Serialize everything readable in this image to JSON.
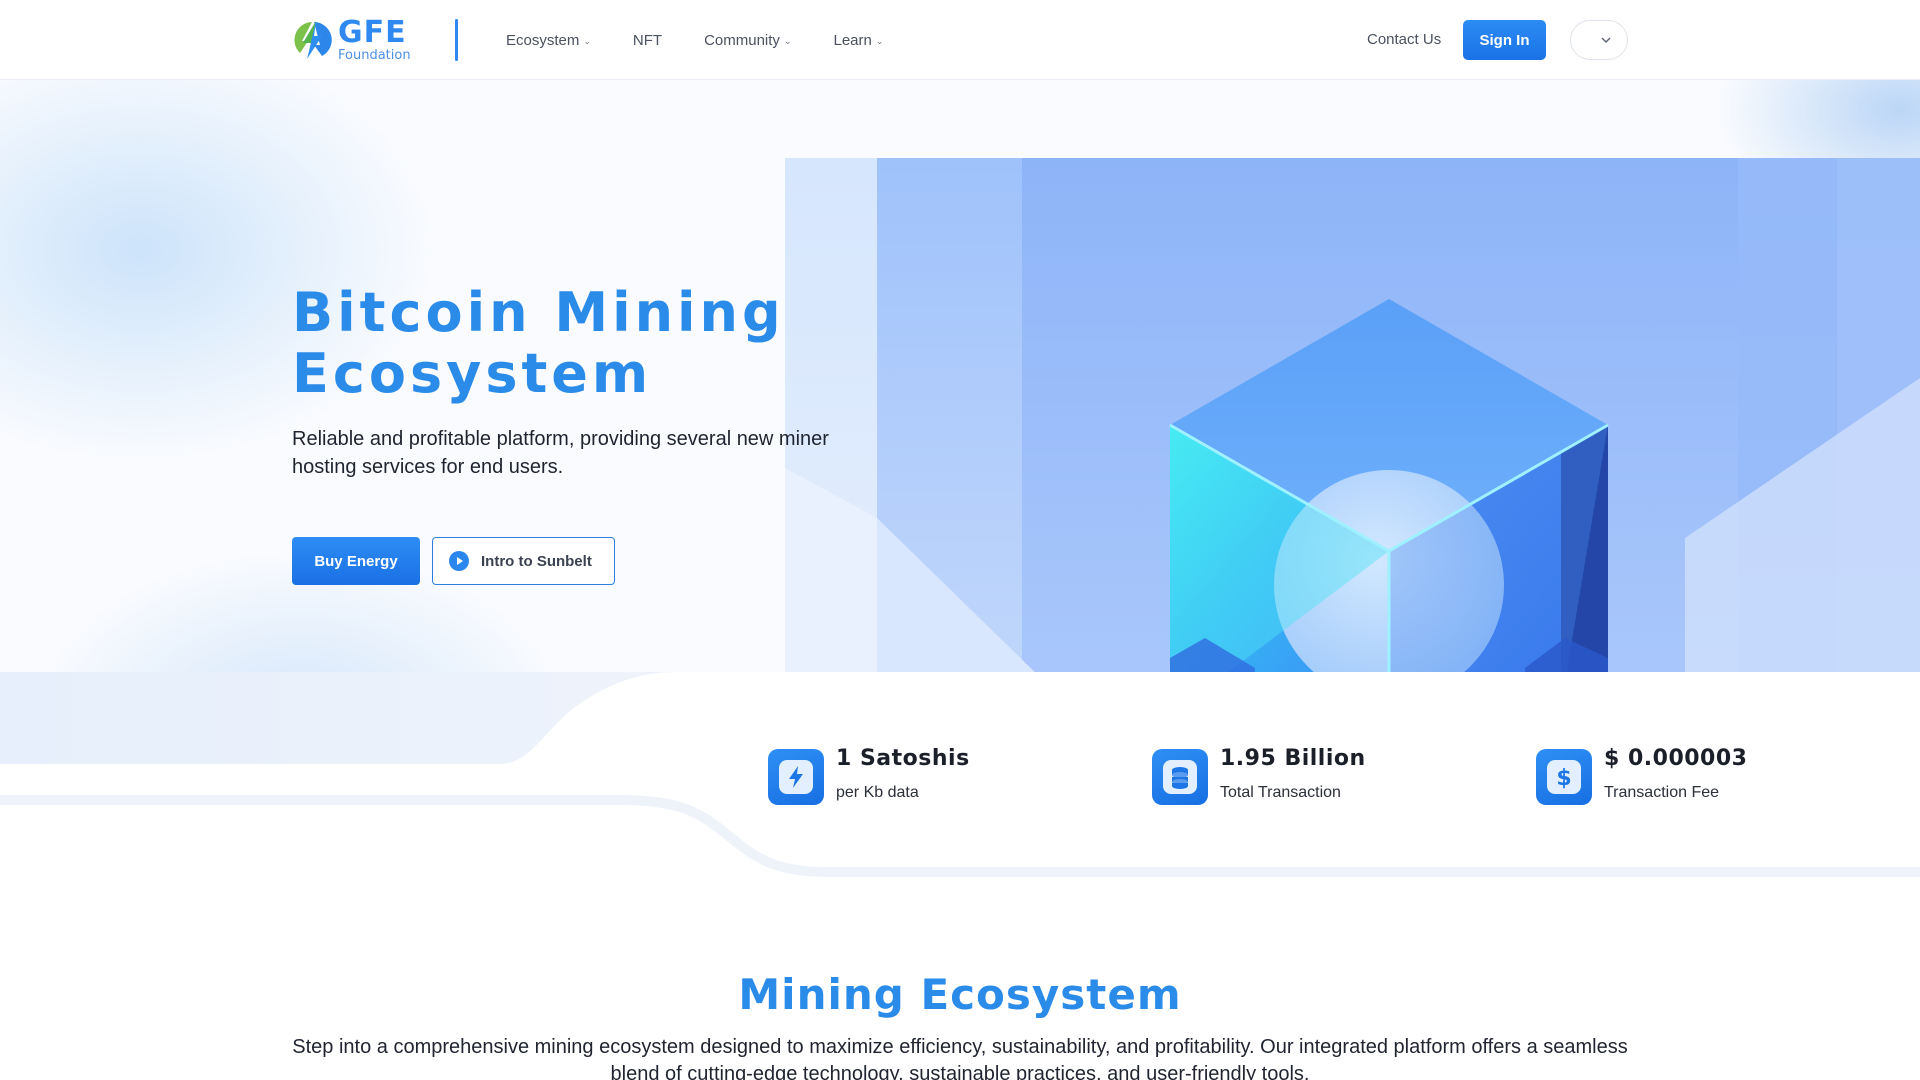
{
  "brand": {
    "name": "GFE",
    "subtitle": "Foundation",
    "colors": {
      "primary": "#2b8be9",
      "button": "#1a72e6",
      "text": "#1f2430"
    }
  },
  "nav": {
    "items": [
      {
        "label": "Ecosystem",
        "has_dropdown": true
      },
      {
        "label": "NFT",
        "has_dropdown": false
      },
      {
        "label": "Community",
        "has_dropdown": true
      },
      {
        "label": "Learn",
        "has_dropdown": true
      }
    ],
    "contact_label": "Contact Us",
    "signin_label": "Sign In",
    "language_icon": "chevron-down-icon"
  },
  "hero": {
    "title_line1": "Bitcoin Mining",
    "title_line2": "Ecosystem",
    "subtitle": "Reliable and profitable platform, providing several new miner hosting services for end users.",
    "primary_button": "Buy Energy",
    "secondary_button": "Intro to Sunbelt",
    "secondary_icon": "play-icon"
  },
  "stats": [
    {
      "value": "1 Satoshis",
      "label": "per Kb data",
      "icon": "lightning-icon"
    },
    {
      "value": "1.95 Billion",
      "label": "Total Transaction",
      "icon": "coin-stack-icon"
    },
    {
      "value": "$ 0.000003",
      "label": "Transaction Fee",
      "icon": "dollar-icon"
    }
  ],
  "section": {
    "title": "Mining Ecosystem",
    "text": "Step into a comprehensive mining ecosystem designed to maximize efficiency, sustainability, and profitability. Our integrated platform offers a seamless blend of cutting-edge technology, sustainable practices, and user-friendly tools."
  }
}
